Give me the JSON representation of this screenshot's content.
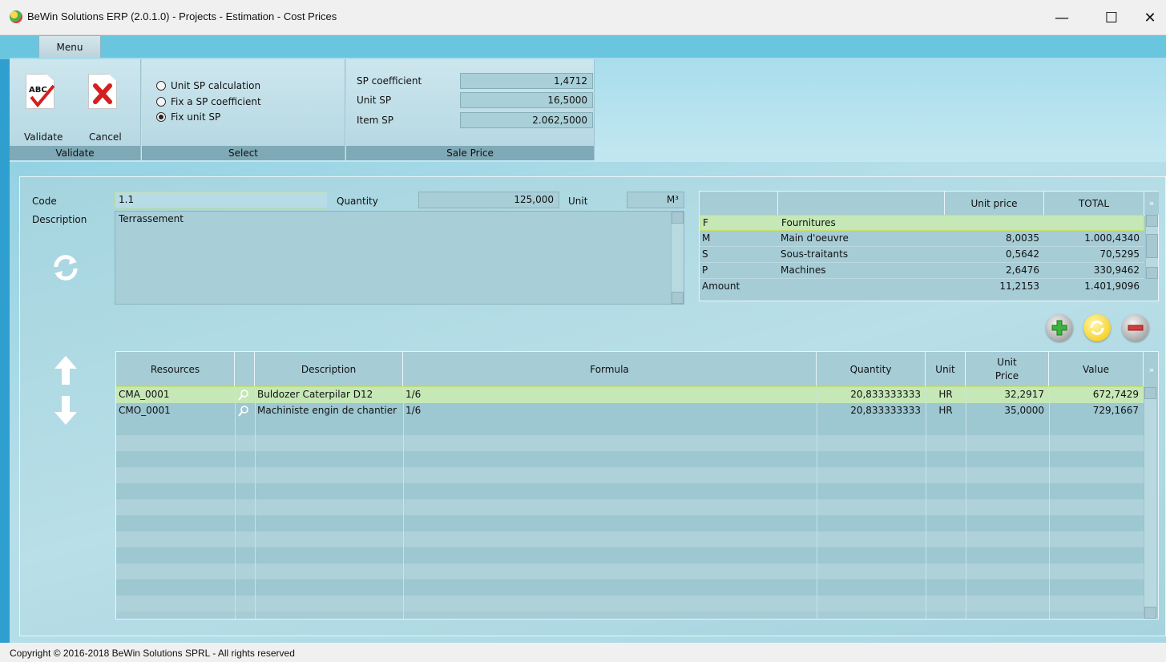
{
  "window": {
    "title": "BeWin Solutions ERP (2.0.1.0) - Projects - Estimation - Cost Prices",
    "minimize_glyph": "—",
    "maximize_glyph": "☐",
    "close_glyph": "✕"
  },
  "ribbon": {
    "menu_tab": "Menu",
    "validate_group": {
      "label": "Validate",
      "validate_button": "Validate",
      "validate_icon_text": "ABC",
      "cancel_button": "Cancel"
    },
    "select_group": {
      "label": "Select",
      "options": [
        {
          "label": "Unit SP calculation",
          "selected": false
        },
        {
          "label": "Fix a SP coefficient",
          "selected": false
        },
        {
          "label": "Fix unit SP",
          "selected": true
        }
      ]
    },
    "sale_price_group": {
      "label": "Sale Price",
      "fields": [
        {
          "label": "SP coefficient",
          "value": "1,4712"
        },
        {
          "label": "Unit SP",
          "value": "16,5000"
        },
        {
          "label": "Item SP",
          "value": "2.062,5000"
        }
      ]
    }
  },
  "item": {
    "code_label": "Code",
    "code_value": "1.1",
    "quantity_label": "Quantity",
    "quantity_value": "125,000",
    "unit_label": "Unit",
    "unit_value": "M³",
    "description_label": "Description",
    "description_value": "Terrassement"
  },
  "summary": {
    "headers": [
      "",
      "",
      "Unit price",
      "TOTAL"
    ],
    "rows": [
      {
        "code": "F",
        "name": "Fournitures",
        "unit_price": "",
        "total": ""
      },
      {
        "code": "M",
        "name": "Main d'oeuvre",
        "unit_price": "8,0035",
        "total": "1.000,4340"
      },
      {
        "code": "S",
        "name": "Sous-traitants",
        "unit_price": "0,5642",
        "total": "70,5295"
      },
      {
        "code": "P",
        "name": "Machines",
        "unit_price": "2,6476",
        "total": "330,9462"
      }
    ],
    "amount_label": "Amount",
    "amount_unit_price": "11,2153",
    "amount_total": "1.401,9096"
  },
  "resources": {
    "headers": {
      "resources": "Resources",
      "description": "Description",
      "formula": "Formula",
      "quantity": "Quantity",
      "unit": "Unit",
      "unit_price_1": "Unit",
      "unit_price_2": "Price",
      "value": "Value"
    },
    "rows": [
      {
        "resource": "CMA_0001",
        "description": "Buldozer Caterpilar D12",
        "formula": "1/6",
        "quantity": "20,833333333",
        "unit": "HR",
        "unit_price": "32,2917",
        "value": "672,7429"
      },
      {
        "resource": "CMO_0001",
        "description": "Machiniste engin de chantier",
        "formula": "1/6",
        "quantity": "20,833333333",
        "unit": "HR",
        "unit_price": "35,0000",
        "value": "729,1667"
      }
    ]
  },
  "footer": {
    "copyright": "Copyright © 2016-2018 BeWin Solutions SPRL - All rights reserved"
  },
  "colors": {
    "selected_row": "#c5e8b6",
    "selected_border": "#c8e06a",
    "panel_bg": "#a6ccd6",
    "ribbon_label_bg": "#7fa9b6"
  }
}
